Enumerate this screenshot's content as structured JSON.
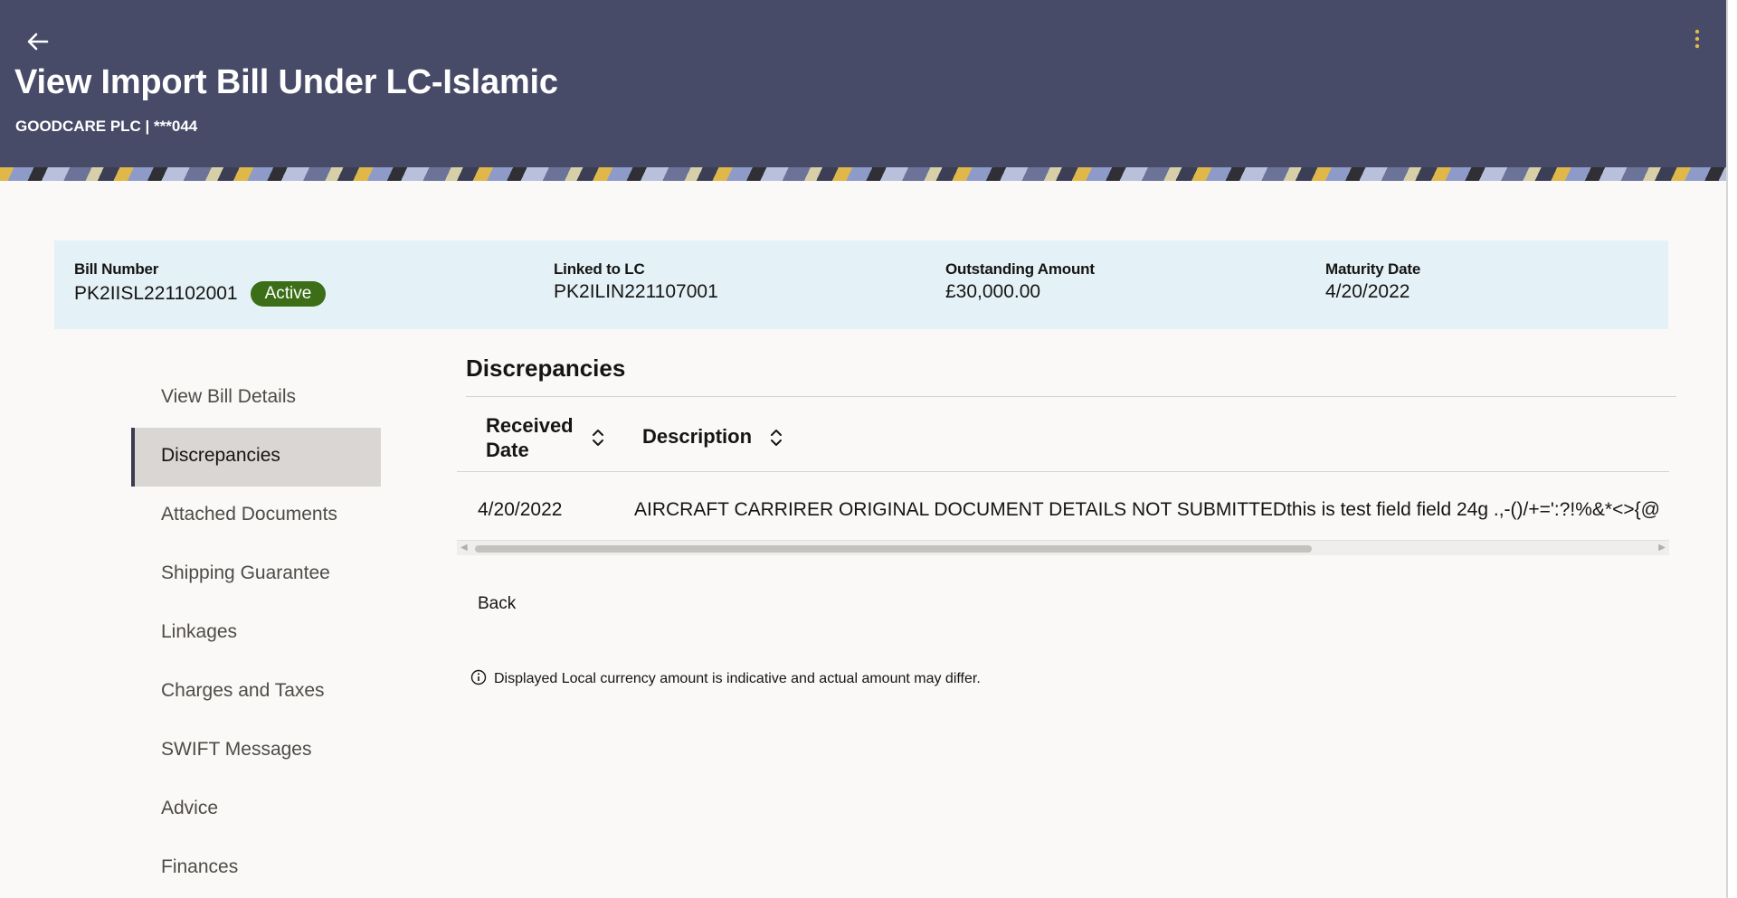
{
  "header": {
    "title": "View Import Bill Under LC-Islamic",
    "subtitle": "GOODCARE PLC | ***044",
    "back_icon": "back-arrow-icon",
    "menu_icon": "kebab-menu-icon",
    "background_color": "#474b68"
  },
  "summary": {
    "bill_number_label": "Bill Number",
    "bill_number": "PK2IISL221102001",
    "status": "Active",
    "status_color": "#3b6e16",
    "linked_lc_label": "Linked to LC",
    "linked_lc": "PK2ILIN221107001",
    "outstanding_label": "Outstanding Amount",
    "outstanding": "£30,000.00",
    "maturity_label": "Maturity Date",
    "maturity": "4/20/2022"
  },
  "sidenav": {
    "items": [
      {
        "label": "View Bill Details"
      },
      {
        "label": "Discrepancies"
      },
      {
        "label": "Attached Documents"
      },
      {
        "label": "Shipping Guarantee"
      },
      {
        "label": "Linkages"
      },
      {
        "label": "Charges and Taxes"
      },
      {
        "label": "SWIFT Messages"
      },
      {
        "label": "Advice"
      },
      {
        "label": "Finances"
      }
    ],
    "active": "Discrepancies"
  },
  "main": {
    "section_title": "Discrepancies",
    "table": {
      "columns": [
        {
          "line1": "Received",
          "line2": "Date"
        },
        {
          "label": "Description"
        }
      ],
      "rows": [
        {
          "received_date": "4/20/2022",
          "description": "AIRCRAFT CARRIRER ORIGINAL DOCUMENT DETAILS NOT SUBMITTEDthis is test field field 24g .,-()/+=':?!%&*<>{@"
        }
      ]
    },
    "back_label": "Back",
    "note": "Displayed Local currency amount is indicative and actual amount may differ.",
    "note_icon": "info-icon"
  }
}
